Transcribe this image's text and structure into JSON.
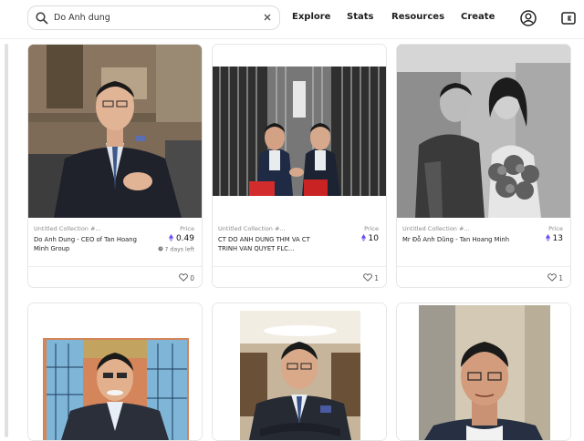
{
  "search": {
    "value": "Do Anh dung"
  },
  "nav": {
    "explore": "Explore",
    "stats": "Stats",
    "resources": "Resources",
    "create": "Create"
  },
  "icons": {
    "search": "search-icon",
    "clear": "close-icon",
    "account": "account-icon",
    "wallet": "wallet-icon",
    "eth": "ethereum-icon",
    "heart": "heart-icon",
    "clock": "clock-icon"
  },
  "colors": {
    "accent": "#6c4cf5",
    "text": "#1e1e1e",
    "muted": "#8a8a8a"
  },
  "cards": [
    {
      "collection": "Untitled Collection #...",
      "price_label": "Price",
      "name": "Do Anh Dung - CEO of Tan Hoang Minh Group",
      "price": "0.49",
      "time": "7 days left",
      "likes": "0"
    },
    {
      "collection": "Untitled Collection #...",
      "price_label": "Price",
      "name": "CT DO ANH DUNG THM VA CT TRINH VAN QUYET FLC...",
      "price": "10",
      "likes": "1"
    },
    {
      "collection": "Untitled Collection #...",
      "price_label": "Price",
      "name": "Mr Đỗ Anh Dũng - Tan Hoang Minh",
      "price": "13",
      "likes": "1"
    },
    {},
    {},
    {}
  ]
}
